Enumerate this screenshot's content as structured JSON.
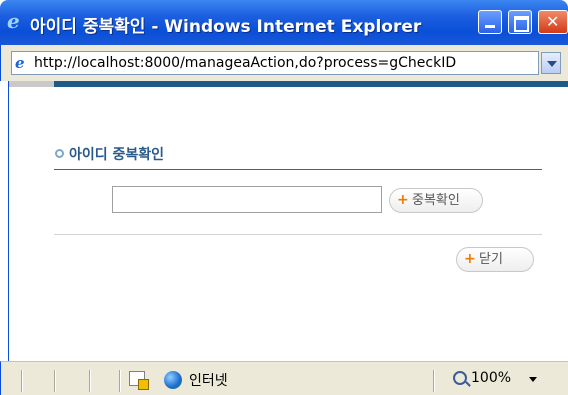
{
  "window": {
    "title": "아이디 중복확인 - Windows Internet Explorer",
    "app_icon": "ie-icon"
  },
  "address": {
    "url": "http://localhost:8000/manageaAction,do?process=gCheckID"
  },
  "page": {
    "section_title": "아이디 중복확인",
    "id_input_value": "",
    "check_button_label": "중복확인",
    "close_button_label": "닫기"
  },
  "statusbar": {
    "zone_label": "인터넷",
    "zoom": "100%"
  },
  "colors": {
    "titlebar": "#0a4fd8",
    "accent_rule": "#1e5b8a",
    "button_plus": "#f07a00"
  }
}
